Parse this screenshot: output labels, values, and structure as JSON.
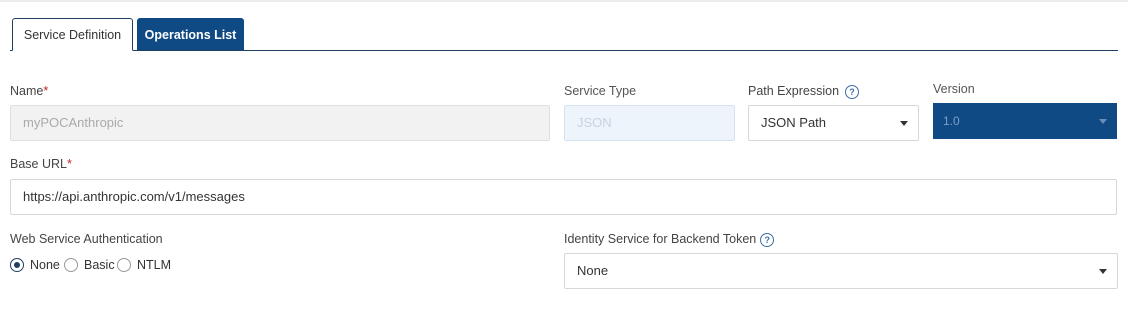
{
  "tabs": [
    {
      "label": "Service Definition",
      "active": true
    },
    {
      "label": "Operations List",
      "active": false
    }
  ],
  "form": {
    "name": {
      "label": "Name",
      "required_mark": "*",
      "value": "myPOCAnthropic"
    },
    "service_type": {
      "label": "Service Type",
      "value": "JSON"
    },
    "path_expression": {
      "label": "Path Expression",
      "help_icon": "question-circle-icon",
      "value": "JSON Path"
    },
    "version": {
      "label": "Version",
      "value": "1.0"
    },
    "base_url": {
      "label": "Base URL",
      "required_mark": "*",
      "value": "https://api.anthropic.com/v1/messages"
    },
    "auth": {
      "label": "Web Service Authentication",
      "options": [
        "None",
        "Basic",
        "NTLM"
      ],
      "selected": "None"
    },
    "identity_service": {
      "label": "Identity Service for Backend Token",
      "help_icon": "question-circle-icon",
      "value": "None"
    }
  },
  "colors": {
    "primary": "#0f4a84",
    "required": "#c0272d",
    "border": "#1f3f63"
  }
}
